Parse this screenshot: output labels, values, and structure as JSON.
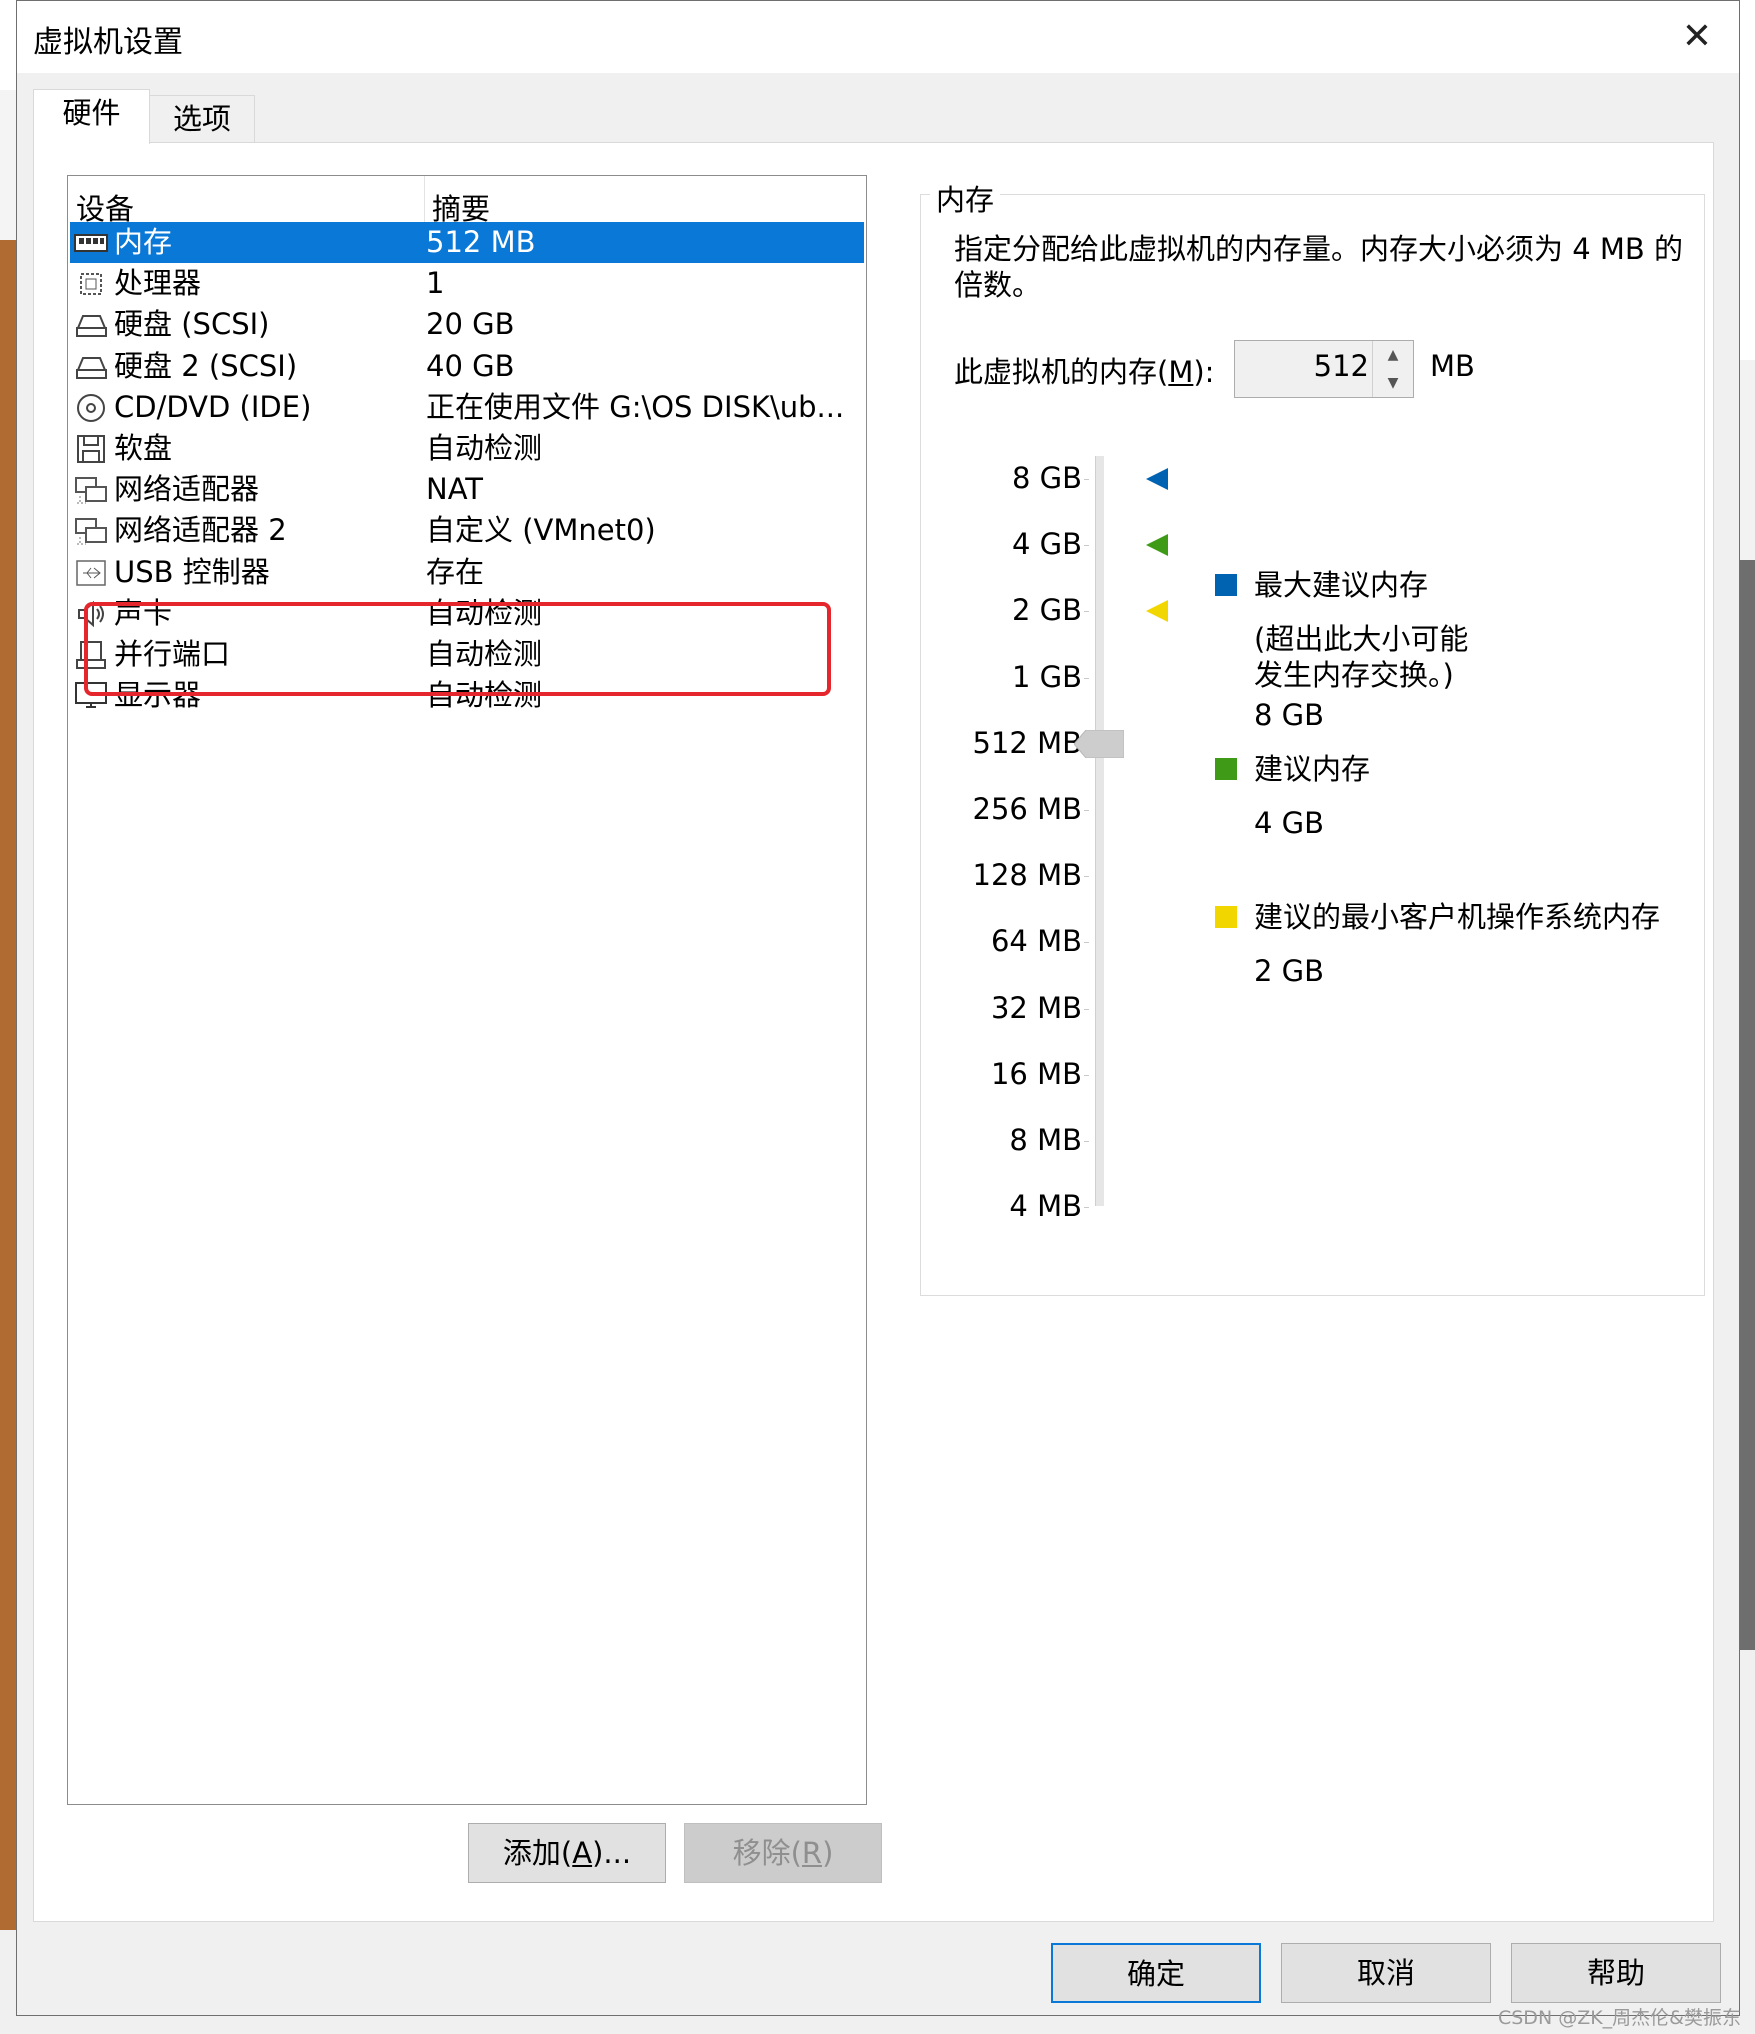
{
  "window": {
    "title": "虚拟机设置",
    "close_glyph": "✕"
  },
  "tabs": [
    {
      "label": "硬件",
      "active": true
    },
    {
      "label": "选项",
      "active": false
    }
  ],
  "device_list": {
    "col_device": "设备",
    "col_summary": "摘要",
    "rows": [
      {
        "name": "内存",
        "summary": "512 MB",
        "icon": "memory-icon",
        "selected": true
      },
      {
        "name": "处理器",
        "summary": "1",
        "icon": "cpu-icon"
      },
      {
        "name": "硬盘 (SCSI)",
        "summary": "20 GB",
        "icon": "hard-disk-icon"
      },
      {
        "name": "硬盘 2 (SCSI)",
        "summary": "40 GB",
        "icon": "hard-disk-icon"
      },
      {
        "name": "CD/DVD (IDE)",
        "summary": "正在使用文件 G:\\OS DISK\\ub...",
        "icon": "cd-dvd-icon"
      },
      {
        "name": "软盘",
        "summary": "自动检测",
        "icon": "floppy-icon"
      },
      {
        "name": "网络适配器",
        "summary": "NAT",
        "icon": "network-adapter-icon"
      },
      {
        "name": "网络适配器 2",
        "summary": "自定义 (VMnet0)",
        "icon": "network-adapter-icon"
      },
      {
        "name": "USB 控制器",
        "summary": "存在",
        "icon": "usb-icon"
      },
      {
        "name": "声卡",
        "summary": "自动检测",
        "icon": "speaker-icon"
      },
      {
        "name": "并行端口",
        "summary": "自动检测",
        "icon": "printer-icon"
      },
      {
        "name": "显示器",
        "summary": "自动检测",
        "icon": "monitor-icon"
      }
    ]
  },
  "list_buttons": {
    "add": {
      "pre": "添加(",
      "key": "A",
      "post": ")..."
    },
    "remove": {
      "pre": "移除(",
      "key": "R",
      "post": ")"
    }
  },
  "memory": {
    "group_title": "内存",
    "description": "指定分配给此虚拟机的内存量。内存大小必须为 4 MB 的倍数。",
    "label_pre": "此虚拟机的内存(",
    "label_key": "M",
    "label_post": "):",
    "value": "512",
    "unit": "MB",
    "scale": [
      "8 GB",
      "4 GB",
      "2 GB",
      "1 GB",
      "512 MB",
      "256 MB",
      "128 MB",
      "64 MB",
      "32 MB",
      "16 MB",
      "8 MB",
      "4 MB"
    ],
    "current_index": 4,
    "markers": [
      {
        "title": "最大建议内存",
        "note": "(超出此大小可能发生内存交换。)",
        "value": "8 GB",
        "color": "#0063b1",
        "scale_index": 0
      },
      {
        "title": "建议内存",
        "value": "4 GB",
        "color": "#3f9a18",
        "scale_index": 1
      },
      {
        "title": "建议的最小客户机操作系统内存",
        "value": "2 GB",
        "color": "#f2d600",
        "scale_index": 2
      }
    ]
  },
  "footer": {
    "ok": "确定",
    "cancel": "取消",
    "help": "帮助"
  },
  "watermark": "CSDN @ZK_周杰伦&樊振东",
  "colors": {
    "selection": "#0a78d7",
    "highlight_box": "#e5262c"
  }
}
